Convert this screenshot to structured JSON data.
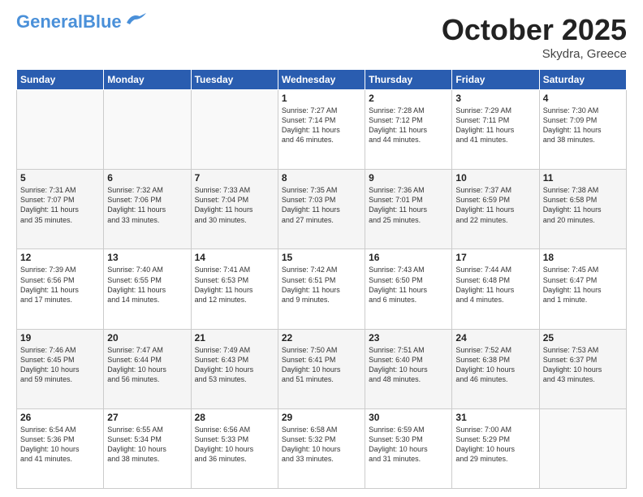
{
  "header": {
    "logo_line1": "General",
    "logo_line2": "Blue",
    "month": "October 2025",
    "location": "Skydra, Greece"
  },
  "weekdays": [
    "Sunday",
    "Monday",
    "Tuesday",
    "Wednesday",
    "Thursday",
    "Friday",
    "Saturday"
  ],
  "weeks": [
    [
      {
        "day": "",
        "info": ""
      },
      {
        "day": "",
        "info": ""
      },
      {
        "day": "",
        "info": ""
      },
      {
        "day": "1",
        "info": "Sunrise: 7:27 AM\nSunset: 7:14 PM\nDaylight: 11 hours\nand 46 minutes."
      },
      {
        "day": "2",
        "info": "Sunrise: 7:28 AM\nSunset: 7:12 PM\nDaylight: 11 hours\nand 44 minutes."
      },
      {
        "day": "3",
        "info": "Sunrise: 7:29 AM\nSunset: 7:11 PM\nDaylight: 11 hours\nand 41 minutes."
      },
      {
        "day": "4",
        "info": "Sunrise: 7:30 AM\nSunset: 7:09 PM\nDaylight: 11 hours\nand 38 minutes."
      }
    ],
    [
      {
        "day": "5",
        "info": "Sunrise: 7:31 AM\nSunset: 7:07 PM\nDaylight: 11 hours\nand 35 minutes."
      },
      {
        "day": "6",
        "info": "Sunrise: 7:32 AM\nSunset: 7:06 PM\nDaylight: 11 hours\nand 33 minutes."
      },
      {
        "day": "7",
        "info": "Sunrise: 7:33 AM\nSunset: 7:04 PM\nDaylight: 11 hours\nand 30 minutes."
      },
      {
        "day": "8",
        "info": "Sunrise: 7:35 AM\nSunset: 7:03 PM\nDaylight: 11 hours\nand 27 minutes."
      },
      {
        "day": "9",
        "info": "Sunrise: 7:36 AM\nSunset: 7:01 PM\nDaylight: 11 hours\nand 25 minutes."
      },
      {
        "day": "10",
        "info": "Sunrise: 7:37 AM\nSunset: 6:59 PM\nDaylight: 11 hours\nand 22 minutes."
      },
      {
        "day": "11",
        "info": "Sunrise: 7:38 AM\nSunset: 6:58 PM\nDaylight: 11 hours\nand 20 minutes."
      }
    ],
    [
      {
        "day": "12",
        "info": "Sunrise: 7:39 AM\nSunset: 6:56 PM\nDaylight: 11 hours\nand 17 minutes."
      },
      {
        "day": "13",
        "info": "Sunrise: 7:40 AM\nSunset: 6:55 PM\nDaylight: 11 hours\nand 14 minutes."
      },
      {
        "day": "14",
        "info": "Sunrise: 7:41 AM\nSunset: 6:53 PM\nDaylight: 11 hours\nand 12 minutes."
      },
      {
        "day": "15",
        "info": "Sunrise: 7:42 AM\nSunset: 6:51 PM\nDaylight: 11 hours\nand 9 minutes."
      },
      {
        "day": "16",
        "info": "Sunrise: 7:43 AM\nSunset: 6:50 PM\nDaylight: 11 hours\nand 6 minutes."
      },
      {
        "day": "17",
        "info": "Sunrise: 7:44 AM\nSunset: 6:48 PM\nDaylight: 11 hours\nand 4 minutes."
      },
      {
        "day": "18",
        "info": "Sunrise: 7:45 AM\nSunset: 6:47 PM\nDaylight: 11 hours\nand 1 minute."
      }
    ],
    [
      {
        "day": "19",
        "info": "Sunrise: 7:46 AM\nSunset: 6:45 PM\nDaylight: 10 hours\nand 59 minutes."
      },
      {
        "day": "20",
        "info": "Sunrise: 7:47 AM\nSunset: 6:44 PM\nDaylight: 10 hours\nand 56 minutes."
      },
      {
        "day": "21",
        "info": "Sunrise: 7:49 AM\nSunset: 6:43 PM\nDaylight: 10 hours\nand 53 minutes."
      },
      {
        "day": "22",
        "info": "Sunrise: 7:50 AM\nSunset: 6:41 PM\nDaylight: 10 hours\nand 51 minutes."
      },
      {
        "day": "23",
        "info": "Sunrise: 7:51 AM\nSunset: 6:40 PM\nDaylight: 10 hours\nand 48 minutes."
      },
      {
        "day": "24",
        "info": "Sunrise: 7:52 AM\nSunset: 6:38 PM\nDaylight: 10 hours\nand 46 minutes."
      },
      {
        "day": "25",
        "info": "Sunrise: 7:53 AM\nSunset: 6:37 PM\nDaylight: 10 hours\nand 43 minutes."
      }
    ],
    [
      {
        "day": "26",
        "info": "Sunrise: 6:54 AM\nSunset: 5:36 PM\nDaylight: 10 hours\nand 41 minutes."
      },
      {
        "day": "27",
        "info": "Sunrise: 6:55 AM\nSunset: 5:34 PM\nDaylight: 10 hours\nand 38 minutes."
      },
      {
        "day": "28",
        "info": "Sunrise: 6:56 AM\nSunset: 5:33 PM\nDaylight: 10 hours\nand 36 minutes."
      },
      {
        "day": "29",
        "info": "Sunrise: 6:58 AM\nSunset: 5:32 PM\nDaylight: 10 hours\nand 33 minutes."
      },
      {
        "day": "30",
        "info": "Sunrise: 6:59 AM\nSunset: 5:30 PM\nDaylight: 10 hours\nand 31 minutes."
      },
      {
        "day": "31",
        "info": "Sunrise: 7:00 AM\nSunset: 5:29 PM\nDaylight: 10 hours\nand 29 minutes."
      },
      {
        "day": "",
        "info": ""
      }
    ]
  ]
}
